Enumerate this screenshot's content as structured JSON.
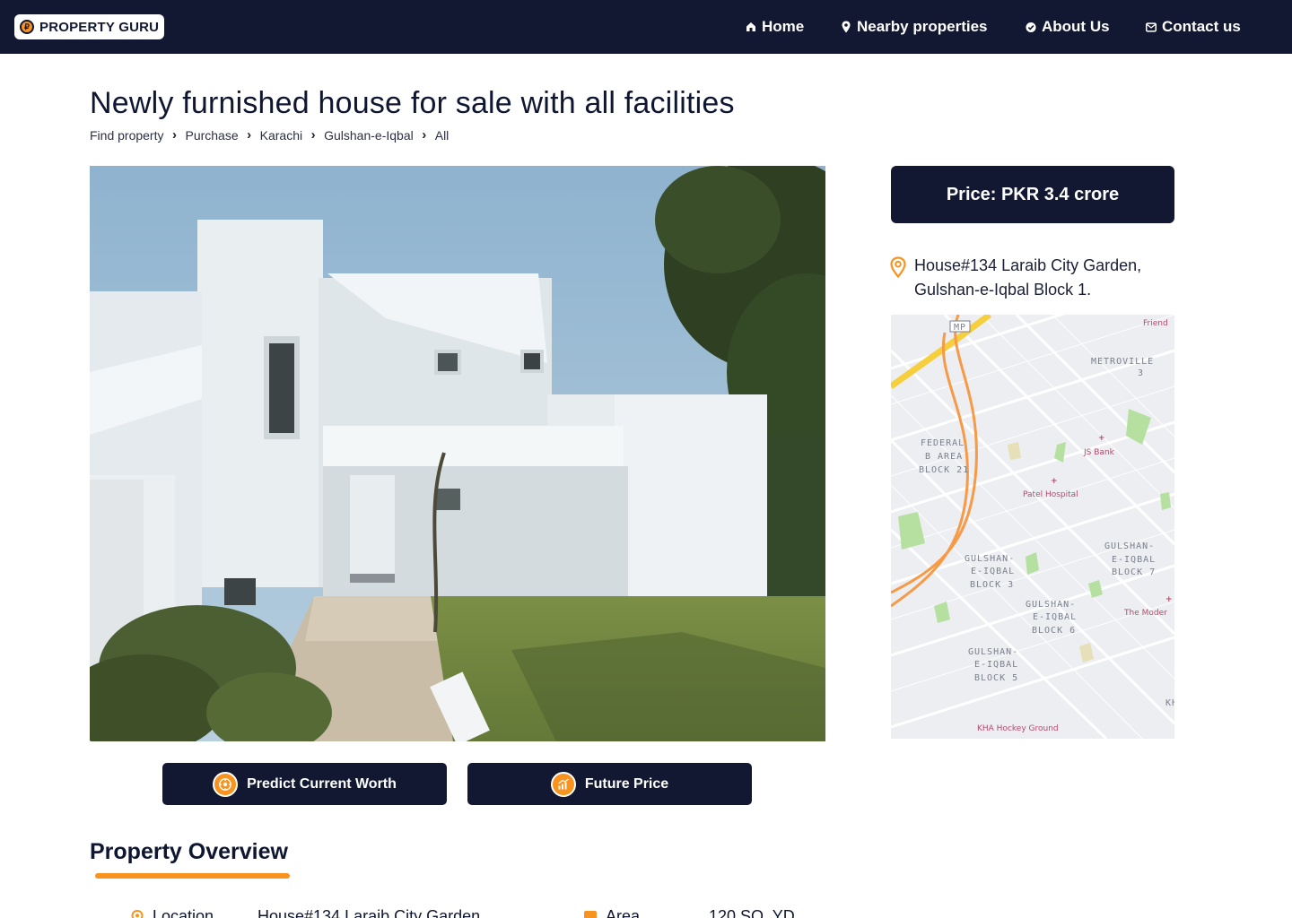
{
  "header": {
    "logo_text": "PROPERTY GURU",
    "nav": [
      {
        "label": "Home",
        "icon": "home-icon"
      },
      {
        "label": "Nearby properties",
        "icon": "map-pin-icon"
      },
      {
        "label": "About Us",
        "icon": "check-badge-icon"
      },
      {
        "label": "Contact us",
        "icon": "mail-icon"
      }
    ]
  },
  "listing": {
    "title": "Newly furnished house for sale with all facilities",
    "breadcrumb": [
      "Find property",
      "Purchase",
      "Karachi",
      "Gulshan-e-Iqbal",
      "All"
    ],
    "price": "Price: PKR 3.4 crore",
    "address_line1": "House#134 Laraib City Garden,",
    "address_line2": "Gulshan-e-Iqbal Block 1."
  },
  "actions": {
    "predict_label": "Predict Current Worth",
    "future_label": "Future Price"
  },
  "map": {
    "labels": {
      "mp": "MP",
      "friend": "Friend",
      "metroville_1": "METROVILLE",
      "metroville_2": "3",
      "federal_1": "FEDERAL",
      "federal_2": "B AREA",
      "federal_3": "BLOCK 21",
      "js_bank": "JS Bank",
      "patel": "Patel Hospital",
      "g3_1": "GULSHAN-",
      "g3_2": "E-IQBAL",
      "g3_3": "BLOCK 3",
      "g7_1": "GULSHAN-",
      "g7_2": "E-IQBAL",
      "g7_3": "BLOCK 7",
      "g6_1": "GULSHAN-",
      "g6_2": "E-IQBAL",
      "g6_3": "BLOCK 6",
      "g5_1": "GULSHAN-",
      "g5_2": "E-IQBAL",
      "g5_3": "BLOCK 5",
      "moder": "The Moder",
      "kh": "KH",
      "khi": "KHA Hockey Ground"
    }
  },
  "overview": {
    "title": "Property Overview",
    "location_label": "Location",
    "location_value": "House#134 Laraib City Garden",
    "area_label": "Area",
    "area_value": "120 SQ. YD"
  },
  "colors": {
    "navy": "#121832",
    "accent": "#f7931e",
    "text": "#0f1631"
  }
}
